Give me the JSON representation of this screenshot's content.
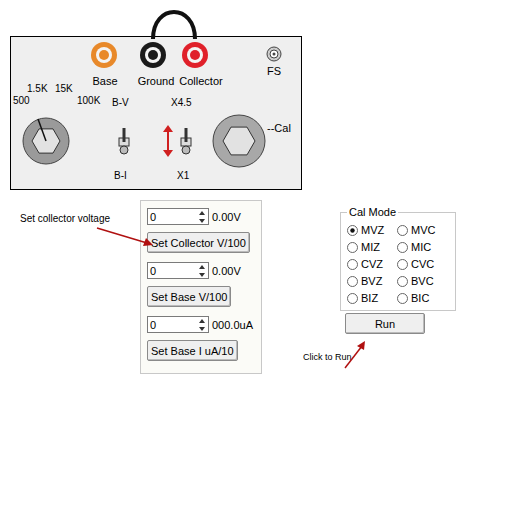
{
  "device_panel": {
    "jacks": [
      {
        "label": "Base",
        "color": "#e8892a"
      },
      {
        "label": "Ground",
        "color": "#1a1a1a"
      },
      {
        "label": "Collector",
        "color": "#e0202a"
      }
    ],
    "fs_jack": {
      "label": "FS"
    },
    "range_knob": {
      "labels": [
        "500",
        "1.5K",
        "15K",
        "100K"
      ]
    },
    "mode_switch": {
      "top": "B-V",
      "bottom": "B-I"
    },
    "gain_switch": {
      "top": "X4.5",
      "bottom": "X1"
    },
    "cal_knob": {
      "label": "--Cal"
    }
  },
  "annotations": [
    {
      "text": "Set collector voltage"
    },
    {
      "text": "Click to Run"
    }
  ],
  "controls": [
    {
      "value": "0",
      "reading": "0.00V",
      "button": "Set Collector V/100"
    },
    {
      "value": "0",
      "reading": "0.00V",
      "button": "Set Base V/100"
    },
    {
      "value": "0",
      "reading": "000.0uA",
      "button": "Set Base I uA/10"
    }
  ],
  "cal_mode": {
    "title": "Cal Mode",
    "options": [
      {
        "label": "MVZ",
        "selected": true
      },
      {
        "label": "MVC",
        "selected": false
      },
      {
        "label": "MIZ",
        "selected": false
      },
      {
        "label": "MIC",
        "selected": false
      },
      {
        "label": "CVZ",
        "selected": false
      },
      {
        "label": "CVC",
        "selected": false
      },
      {
        "label": "BVZ",
        "selected": false
      },
      {
        "label": "BVC",
        "selected": false
      },
      {
        "label": "BIZ",
        "selected": false
      },
      {
        "label": "BIC",
        "selected": false
      }
    ]
  },
  "run_button": {
    "label": "Run"
  }
}
